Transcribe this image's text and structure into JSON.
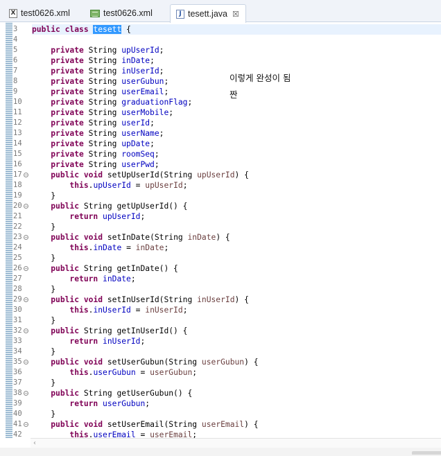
{
  "tabs": [
    {
      "label": "test0626.xml",
      "icon": "xml-file-icon",
      "active": false
    },
    {
      "label": "test0626.xml",
      "icon": "xml-design-file-icon",
      "active": false
    },
    {
      "label": "tesett.java",
      "icon": "java-file-icon",
      "active": true,
      "close": "☒"
    }
  ],
  "overlay": {
    "line1": "이렇게 완성이 됨",
    "line2": "짠"
  },
  "class_header": {
    "prefix": "public class ",
    "name": "tesett",
    "suffix": " {"
  },
  "fields": [
    {
      "line": "5",
      "type": "String",
      "name": "upUserId"
    },
    {
      "line": "6",
      "type": "String",
      "name": "inDate"
    },
    {
      "line": "7",
      "type": "String",
      "name": "inUserId"
    },
    {
      "line": "8",
      "type": "String",
      "name": "userGubun"
    },
    {
      "line": "9",
      "type": "String",
      "name": "userEmail"
    },
    {
      "line": "10",
      "type": "String",
      "name": "graduationFlag"
    },
    {
      "line": "11",
      "type": "String",
      "name": "userMobile"
    },
    {
      "line": "12",
      "type": "String",
      "name": "userId"
    },
    {
      "line": "13",
      "type": "String",
      "name": "userName"
    },
    {
      "line": "14",
      "type": "String",
      "name": "upDate"
    },
    {
      "line": "15",
      "type": "String",
      "name": "roomSeq"
    },
    {
      "line": "16",
      "type": "String",
      "name": "userPwd"
    }
  ],
  "methods": [
    {
      "kind": "setter",
      "line": "17",
      "name": "setUpUserId",
      "field": "upUserId"
    },
    {
      "kind": "getter",
      "line": "20",
      "name": "getUpUserId",
      "field": "upUserId"
    },
    {
      "kind": "setter",
      "line": "23",
      "name": "setInDate",
      "field": "inDate"
    },
    {
      "kind": "getter",
      "line": "26",
      "name": "getInDate",
      "field": "inDate"
    },
    {
      "kind": "setter",
      "line": "29",
      "name": "setInUserId",
      "field": "inUserId"
    },
    {
      "kind": "getter",
      "line": "32",
      "name": "getInUserId",
      "field": "inUserId"
    },
    {
      "kind": "setter",
      "line": "35",
      "name": "setUserGubun",
      "field": "userGubun"
    },
    {
      "kind": "getter",
      "line": "38",
      "name": "getUserGubun",
      "field": "userGubun"
    },
    {
      "kind": "setter",
      "line": "41",
      "name": "setUserEmail",
      "field": "userEmail",
      "partial": true
    }
  ],
  "colors": {
    "keyword": "#7f0055",
    "field": "#0000c0",
    "parameter": "#6a3e3e",
    "selection": "#3399ff",
    "line_numbers": "#787878"
  },
  "scrollbar_arrow": "‹"
}
